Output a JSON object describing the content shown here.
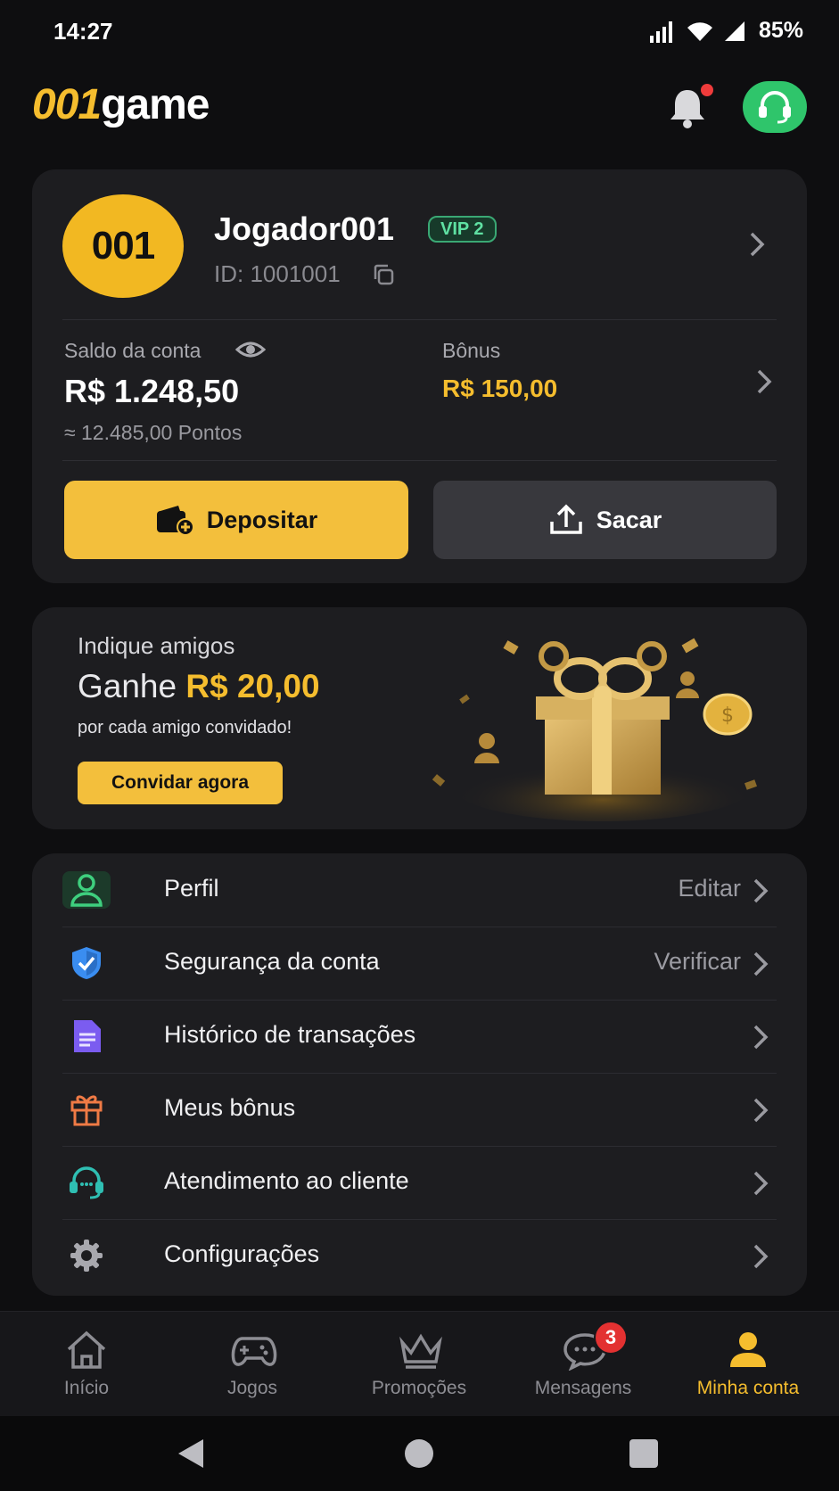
{
  "status_bar": {
    "time": "14:27",
    "battery": "85%"
  },
  "header": {
    "logo_number": "001",
    "logo_word": "game"
  },
  "account": {
    "avatar_text": "001",
    "username": "Jogador001",
    "vip": "VIP 2",
    "user_id": "ID: 1001001",
    "balance_label": "Saldo da conta",
    "balance_value": "R$ 1.248,50",
    "points": "≈ 12.485,00 Pontos",
    "bonus_label": "Bônus",
    "bonus_value": "R$ 150,00",
    "deposit_label": "Depositar",
    "withdraw_label": "Sacar"
  },
  "referral": {
    "title": "Indique amigos",
    "headline_prefix": "Ganhe ",
    "headline_amount": "R$ 20,00",
    "subtitle": "por cada amigo convidado!",
    "button": "Convidar agora"
  },
  "menu": {
    "items": [
      {
        "label": "Perfil",
        "meta": "Editar",
        "icon": "user-icon",
        "color": "#3ecf7e"
      },
      {
        "label": "Segurança da conta",
        "meta": "Verificar",
        "icon": "shield-icon",
        "color": "#3a8df0"
      },
      {
        "label": "Histórico de transações",
        "meta": "",
        "icon": "document-icon",
        "color": "#7b5cf0"
      },
      {
        "label": "Meus bônus",
        "meta": "",
        "icon": "gift-icon",
        "color": "#ef7a45"
      },
      {
        "label": "Atendimento ao cliente",
        "meta": "",
        "icon": "headset-icon",
        "color": "#2fbfb3"
      },
      {
        "label": "Configurações",
        "meta": "",
        "icon": "gear-icon",
        "color": "#a8a8ae"
      }
    ]
  },
  "bottom_nav": {
    "items": [
      {
        "label": "Início",
        "icon": "home-icon"
      },
      {
        "label": "Jogos",
        "icon": "gamepad-icon"
      },
      {
        "label": "Promoções",
        "icon": "crown-icon"
      },
      {
        "label": "Mensagens",
        "icon": "chat-icon",
        "badge": "3"
      },
      {
        "label": "Minha conta",
        "icon": "person-icon",
        "active": true
      }
    ]
  },
  "colors": {
    "accent": "#f5bd2e",
    "background": "#0e0e10",
    "card": "#1d1d20",
    "support": "#2fc56b"
  }
}
